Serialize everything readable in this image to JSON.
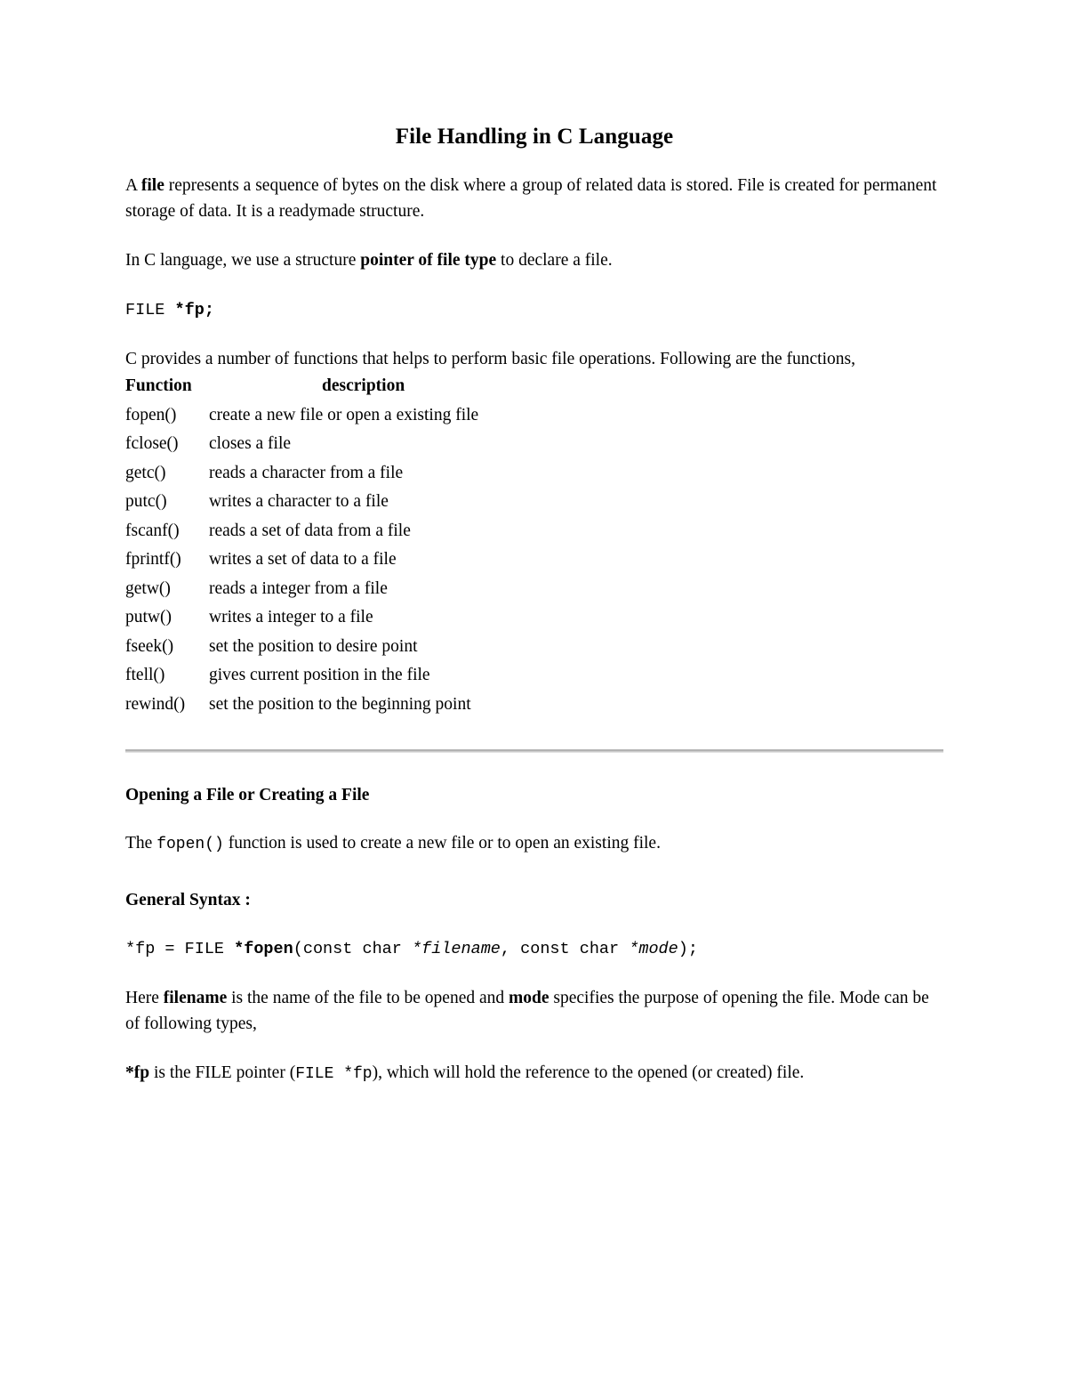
{
  "document": {
    "title": "File Handling in C Language",
    "intro_paragraph": {
      "lead": "A ",
      "bold_word": "file",
      "rest": " represents a sequence of bytes on the disk where a group of related data is stored. File is created for permanent storage of data. It is a readymade structure."
    },
    "declare_paragraph": {
      "lead": "In C language, we use a structure ",
      "bold_phrase": "pointer of file type",
      "rest": " to declare a file."
    },
    "declare_code": {
      "plain": "FILE ",
      "bold": "*fp;"
    },
    "functions_intro": "C provides a number of functions that helps to perform basic file operations. Following are the functions,",
    "function_table": {
      "headers": {
        "function": "Function",
        "description": "description"
      },
      "rows": [
        {
          "function": "fopen()",
          "description": "create a new file or open a existing file"
        },
        {
          "function": "fclose()",
          "description": "closes a file"
        },
        {
          "function": "getc()",
          "description": "reads a character from a file"
        },
        {
          "function": "putc()",
          "description": "writes a character to a file"
        },
        {
          "function": "fscanf()",
          "description": "reads a set of data from a file"
        },
        {
          "function": "fprintf()",
          "description": "writes a set of data to a file"
        },
        {
          "function": "getw()",
          "description": "reads a integer from a file"
        },
        {
          "function": "putw()",
          "description": "writes a integer to a file"
        },
        {
          "function": "fseek()",
          "description": "set the position to desire point"
        },
        {
          "function": "ftell()",
          "description": "gives current position in the file"
        },
        {
          "function": "rewind()",
          "description": "set the position to the beginning point"
        }
      ]
    },
    "opening_section": {
      "heading": "Opening a File or Creating a File",
      "paragraph": {
        "lead": "The ",
        "code": "fopen()",
        "rest": " function is used to create a new file or to open an existing file."
      }
    },
    "general_syntax": {
      "heading": "General Syntax :",
      "code": {
        "part1": "*fp = FILE ",
        "part2_bold": "*fopen",
        "part3": "(const char ",
        "part4_italic": "*filename",
        "part5": ", const char ",
        "part6_italic": "*mode",
        "part7": ");"
      }
    },
    "filename_paragraph": {
      "lead": "Here ",
      "bold1": "filename",
      "mid": " is the name of the file to be opened and ",
      "bold2": "mode",
      "rest": " specifies the purpose of opening the file. Mode can be of following types,"
    },
    "fp_paragraph": {
      "bold1": "*fp",
      "mid1": " is the FILE pointer (",
      "code": "FILE  *fp",
      "rest": "), which will hold the reference to the opened (or created) file."
    }
  },
  "colors": {
    "text": "#000000",
    "background": "#ffffff",
    "divider": "#b0b0b0"
  }
}
